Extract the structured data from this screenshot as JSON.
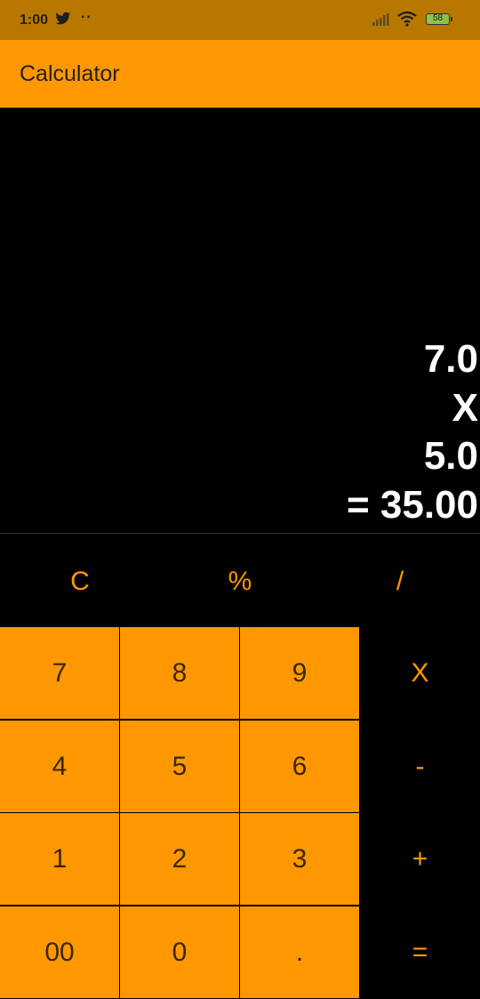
{
  "status": {
    "time": "1:00",
    "dots": "··",
    "battery": "58",
    "icons": [
      "twitter-icon",
      "signal-icon",
      "wifi-icon",
      "battery-icon"
    ]
  },
  "app": {
    "title": "Calculator",
    "accent": "#ff9800"
  },
  "display": {
    "line1": "7.0",
    "line2": "X",
    "line3": "5.0",
    "line4": "= 35.00"
  },
  "function_keys": [
    "C",
    "%",
    "/"
  ],
  "keypad": {
    "rows": [
      [
        "7",
        "8",
        "9"
      ],
      [
        "4",
        "5",
        "6"
      ],
      [
        "1",
        "2",
        "3"
      ],
      [
        "00",
        "0",
        "."
      ]
    ],
    "operators": [
      "X",
      "-",
      "+",
      "="
    ]
  }
}
